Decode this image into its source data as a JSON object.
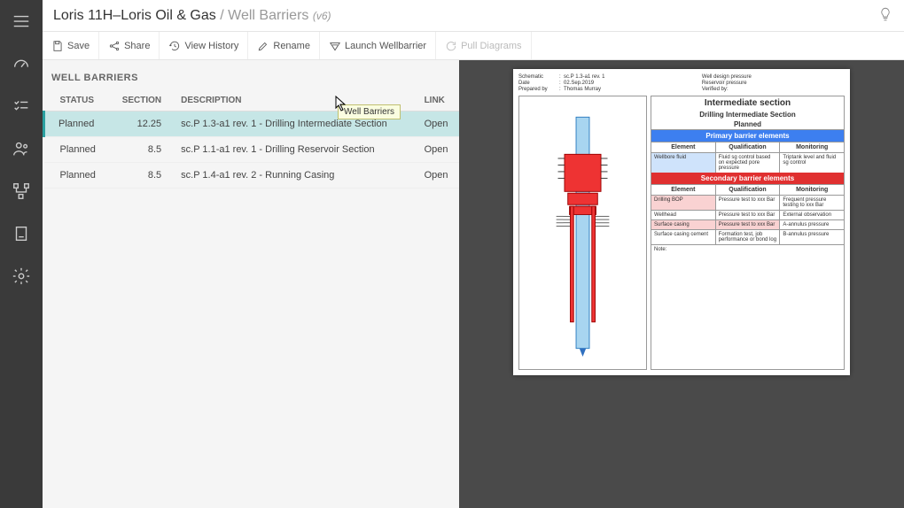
{
  "breadcrumb": {
    "project": "Loris 11H–Loris Oil & Gas",
    "page": "Well Barriers",
    "version": "(v6)"
  },
  "toolbar": {
    "save": "Save",
    "share": "Share",
    "history": "View History",
    "rename": "Rename",
    "launch": "Launch Wellbarrier",
    "pull": "Pull Diagrams"
  },
  "panel_title": "WELL BARRIERS",
  "columns": {
    "status": "STATUS",
    "section": "SECTION",
    "description": "DESCRIPTION",
    "link": "LINK"
  },
  "rows": [
    {
      "status": "Planned",
      "section": "12.25",
      "description": "sc.P 1.3-a1 rev. 1 - Drilling Intermediate Section",
      "link": "Open"
    },
    {
      "status": "Planned",
      "section": "8.5",
      "description": "sc.P 1.1-a1 rev. 1 - Drilling Reservoir Section",
      "link": "Open"
    },
    {
      "status": "Planned",
      "section": "8.5",
      "description": "sc.P 1.4-a1 rev. 2 - Running Casing",
      "link": "Open"
    }
  ],
  "tooltip": "Well Barriers",
  "doc": {
    "meta_left": [
      {
        "label": "Schematic",
        "value": "sc.P 1.3-a1 rev. 1"
      },
      {
        "label": "Date",
        "value": "02.Sep.2019"
      },
      {
        "label": "Prepared by",
        "value": "Thomas Murray"
      }
    ],
    "meta_right": [
      {
        "label": "Well design pressure",
        "value": ""
      },
      {
        "label": "Reservoir pressure",
        "value": ""
      },
      {
        "label": "Verified by",
        "value": ""
      }
    ],
    "title": "Intermediate section",
    "subtitle": "Drilling Intermediate Section",
    "status": "Planned",
    "primary_hdr": "Primary barrier elements",
    "secondary_hdr": "Secondary barrier elements",
    "col_el": "Element",
    "col_qual": "Qualification",
    "col_mon": "Monitoring",
    "primary_rows": [
      {
        "el": "Wellbore fluid",
        "qual": "Fluid sg control based on expected pore pressure",
        "mon": "Triptank level and fluid sg control"
      }
    ],
    "secondary_rows": [
      {
        "el": "Drilling BOP",
        "qual": "Pressure test to xxx Bar",
        "mon": "Frequent pressure testing to xxx Bar"
      },
      {
        "el": "Wellhead",
        "qual": "Pressure test to xxx Bar",
        "mon": "External observation"
      },
      {
        "el": "Surface casing",
        "qual": "Pressure test to xxx Bar",
        "mon": "A-annulus pressure"
      },
      {
        "el": "Surface casing cement",
        "qual": "Formation test, job performance or bond log",
        "mon": "B-annulus pressure"
      }
    ],
    "note_label": "Note:"
  }
}
